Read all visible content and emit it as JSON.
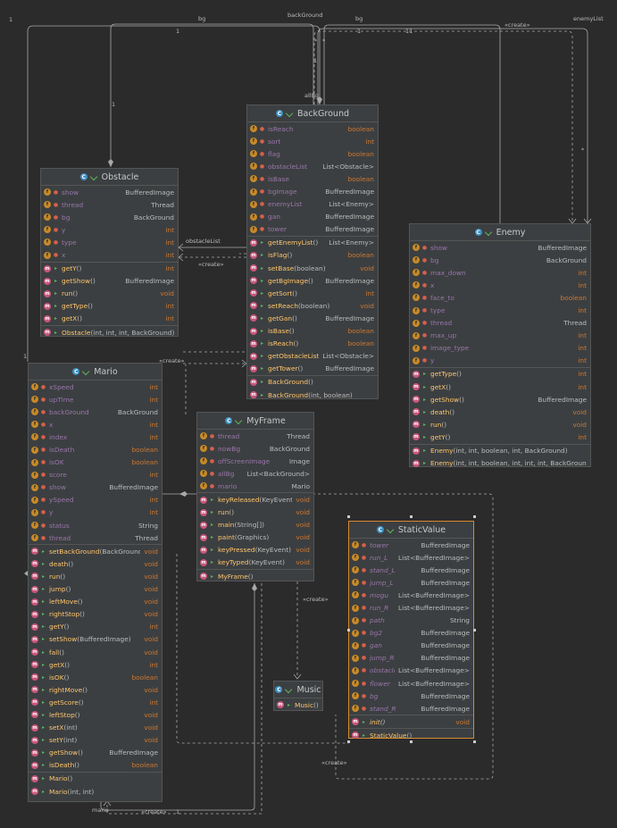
{
  "colors": {
    "background": "#2b2b2b",
    "box": "#3c3f41",
    "border": "#555555",
    "field_name": "#9876aa",
    "method_name": "#ffc66d",
    "primitive_type": "#cc7832",
    "selected_border": "#d88a2e"
  },
  "classes": {
    "obstacle": {
      "name": "Obstacle",
      "icon": "class-icon",
      "fields": [
        {
          "name": "show",
          "type": "BufferedImage"
        },
        {
          "name": "thread",
          "type": "Thread"
        },
        {
          "name": "bg",
          "type": "BackGround"
        },
        {
          "name": "y",
          "type": "int"
        },
        {
          "name": "type",
          "type": "int"
        },
        {
          "name": "x",
          "type": "int"
        }
      ],
      "methods": [
        {
          "name": "getY",
          "params": "()",
          "type": "int"
        },
        {
          "name": "getShow",
          "params": "()",
          "type": "BufferedImage"
        },
        {
          "name": "run",
          "params": "()",
          "type": "void"
        },
        {
          "name": "getType",
          "params": "()",
          "type": "int"
        },
        {
          "name": "getX",
          "params": "()",
          "type": "int"
        }
      ],
      "constructors": [
        {
          "name": "Obstacle",
          "params": "(int, int, int, BackGround)"
        }
      ]
    },
    "background": {
      "name": "BackGround",
      "icon": "class-icon",
      "fields": [
        {
          "name": "isReach",
          "type": "boolean"
        },
        {
          "name": "sort",
          "type": "int"
        },
        {
          "name": "flag",
          "type": "boolean"
        },
        {
          "name": "obstacleList",
          "type": "List<Obstacle>"
        },
        {
          "name": "isBase",
          "type": "boolean"
        },
        {
          "name": "bgImage",
          "type": "BufferedImage"
        },
        {
          "name": "enemyList",
          "type": "List<Enemy>"
        },
        {
          "name": "gan",
          "type": "BufferedImage"
        },
        {
          "name": "tower",
          "type": "BufferedImage"
        }
      ],
      "methods": [
        {
          "name": "getEnemyList",
          "params": "()",
          "type": "List<Enemy>"
        },
        {
          "name": "isFlag",
          "params": "()",
          "type": "boolean"
        },
        {
          "name": "setBase",
          "params": "(boolean)",
          "type": "void"
        },
        {
          "name": "getBgImage",
          "params": "()",
          "type": "BufferedImage"
        },
        {
          "name": "getSort",
          "params": "()",
          "type": "int"
        },
        {
          "name": "setReach",
          "params": "(boolean)",
          "type": "void"
        },
        {
          "name": "getGan",
          "params": "()",
          "type": "BufferedImage"
        },
        {
          "name": "isBase",
          "params": "()",
          "type": "boolean"
        },
        {
          "name": "isReach",
          "params": "()",
          "type": "boolean"
        },
        {
          "name": "getObstacleList",
          "params": "()",
          "type": "List<Obstacle>"
        },
        {
          "name": "getTower",
          "params": "()",
          "type": "BufferedImage"
        }
      ],
      "constructors": [
        {
          "name": "BackGround",
          "params": "()"
        },
        {
          "name": "BackGround",
          "params": "(int, boolean)"
        }
      ]
    },
    "enemy": {
      "name": "Enemy",
      "icon": "class-icon",
      "fields": [
        {
          "name": "show",
          "type": "BufferedImage"
        },
        {
          "name": "bg",
          "type": "BackGround"
        },
        {
          "name": "max_down",
          "type": "int"
        },
        {
          "name": "x",
          "type": "int"
        },
        {
          "name": "face_to",
          "type": "boolean"
        },
        {
          "name": "type",
          "type": "int"
        },
        {
          "name": "thread",
          "type": "Thread"
        },
        {
          "name": "max_up",
          "type": "int"
        },
        {
          "name": "image_type",
          "type": "int"
        },
        {
          "name": "y",
          "type": "int"
        }
      ],
      "methods": [
        {
          "name": "getType",
          "params": "()",
          "type": "int"
        },
        {
          "name": "getX",
          "params": "()",
          "type": "int"
        },
        {
          "name": "getShow",
          "params": "()",
          "type": "BufferedImage"
        },
        {
          "name": "death",
          "params": "()",
          "type": "void"
        },
        {
          "name": "run",
          "params": "()",
          "type": "void"
        },
        {
          "name": "getY",
          "params": "()",
          "type": "int"
        }
      ],
      "constructors": [
        {
          "name": "Enemy",
          "params": "(int, int, boolean, int, BackGround)"
        },
        {
          "name": "Enemy",
          "params": "(int, int, boolean, int, int, int, BackGround)"
        }
      ]
    },
    "mario": {
      "name": "Mario",
      "icon": "class-icon",
      "fields": [
        {
          "name": "xSpeed",
          "type": "int"
        },
        {
          "name": "upTime",
          "type": "int"
        },
        {
          "name": "backGround",
          "type": "BackGround"
        },
        {
          "name": "x",
          "type": "int"
        },
        {
          "name": "index",
          "type": "int"
        },
        {
          "name": "isDeath",
          "type": "boolean"
        },
        {
          "name": "isOK",
          "type": "boolean"
        },
        {
          "name": "score",
          "type": "int"
        },
        {
          "name": "show",
          "type": "BufferedImage"
        },
        {
          "name": "ySpeed",
          "type": "int"
        },
        {
          "name": "y",
          "type": "int"
        },
        {
          "name": "status",
          "type": "String"
        },
        {
          "name": "thread",
          "type": "Thread"
        }
      ],
      "methods": [
        {
          "name": "setBackGround",
          "params": "(BackGround)",
          "type": "void"
        },
        {
          "name": "death",
          "params": "()",
          "type": "void"
        },
        {
          "name": "run",
          "params": "()",
          "type": "void"
        },
        {
          "name": "jump",
          "params": "()",
          "type": "void"
        },
        {
          "name": "leftMove",
          "params": "()",
          "type": "void"
        },
        {
          "name": "rightStop",
          "params": "()",
          "type": "void"
        },
        {
          "name": "getY",
          "params": "()",
          "type": "int"
        },
        {
          "name": "setShow",
          "params": "(BufferedImage)",
          "type": "void"
        },
        {
          "name": "fall",
          "params": "()",
          "type": "void"
        },
        {
          "name": "getX",
          "params": "()",
          "type": "int"
        },
        {
          "name": "isOK",
          "params": "()",
          "type": "boolean"
        },
        {
          "name": "rightMove",
          "params": "()",
          "type": "void"
        },
        {
          "name": "getScore",
          "params": "()",
          "type": "int"
        },
        {
          "name": "leftStop",
          "params": "()",
          "type": "void"
        },
        {
          "name": "setX",
          "params": "(int)",
          "type": "void"
        },
        {
          "name": "setY",
          "params": "(int)",
          "type": "void"
        },
        {
          "name": "getShow",
          "params": "()",
          "type": "BufferedImage"
        },
        {
          "name": "isDeath",
          "params": "()",
          "type": "boolean"
        }
      ],
      "constructors": [
        {
          "name": "Mario",
          "params": "()"
        },
        {
          "name": "Mario",
          "params": "(int, int)"
        }
      ]
    },
    "myframe": {
      "name": "MyFrame",
      "icon": "class-icon",
      "fields": [
        {
          "name": "thread",
          "type": "Thread"
        },
        {
          "name": "nowBg",
          "type": "BackGround"
        },
        {
          "name": "offScreenImage",
          "type": "Image"
        },
        {
          "name": "allBg",
          "type": "List<BackGround>"
        },
        {
          "name": "mario",
          "type": "Mario"
        }
      ],
      "methods": [
        {
          "name": "keyReleased",
          "params": "(KeyEvent)",
          "type": "void"
        },
        {
          "name": "run",
          "params": "()",
          "type": "void"
        },
        {
          "name": "main",
          "params": "(String[])",
          "type": "void"
        },
        {
          "name": "paint",
          "params": "(Graphics)",
          "type": "void"
        },
        {
          "name": "keyPressed",
          "params": "(KeyEvent)",
          "type": "void"
        },
        {
          "name": "keyTyped",
          "params": "(KeyEvent)",
          "type": "void"
        }
      ],
      "constructors": [
        {
          "name": "MyFrame",
          "params": "()"
        }
      ]
    },
    "music": {
      "name": "Music",
      "icon": "class-icon",
      "fields": [],
      "methods": [],
      "constructors": [
        {
          "name": "Music",
          "params": "()"
        }
      ]
    },
    "staticvalue": {
      "name": "StaticValue",
      "icon": "class-icon",
      "fields": [
        {
          "name": "tower",
          "type": "BufferedImage"
        },
        {
          "name": "run_L",
          "type": "List<BufferedImage>"
        },
        {
          "name": "stand_L",
          "type": "BufferedImage"
        },
        {
          "name": "jump_L",
          "type": "BufferedImage"
        },
        {
          "name": "mogu",
          "type": "List<BufferedImage>"
        },
        {
          "name": "run_R",
          "type": "List<BufferedImage>"
        },
        {
          "name": "path",
          "type": "String"
        },
        {
          "name": "bg2",
          "type": "BufferedImage"
        },
        {
          "name": "gan",
          "type": "BufferedImage"
        },
        {
          "name": "jump_R",
          "type": "BufferedImage"
        },
        {
          "name": "obstacle",
          "type": "List<BufferedImage>"
        },
        {
          "name": "flower",
          "type": "List<BufferedImage>"
        },
        {
          "name": "bg",
          "type": "BufferedImage"
        },
        {
          "name": "stand_R",
          "type": "BufferedImage"
        }
      ],
      "methods": [
        {
          "name": "init",
          "params": "()",
          "type": "void"
        }
      ],
      "constructors": [
        {
          "name": "StaticValue",
          "params": "()"
        }
      ]
    }
  },
  "edge_labels": {
    "one_topleft": "1",
    "bg_top_left": "bg",
    "backGround_top": "backGround",
    "bg_top_right": "bg",
    "enemyList_top": "enemyList",
    "create_top": "«create»",
    "one_a": "1",
    "one_b": "1",
    "eleven": "11",
    "one_c": "1",
    "star_a": "*",
    "star_b": "*",
    "one_d": "1",
    "star_c": "*",
    "allBg": "allBg",
    "obstacleList_mid": "obstacleList",
    "create_mid": "«create»",
    "create_mario": "«create»",
    "create_music": "«create»",
    "create_static": "«create»",
    "one_e": "1",
    "mario_bottom": "mario",
    "create_bottom": "«create»",
    "one_f": "1"
  }
}
